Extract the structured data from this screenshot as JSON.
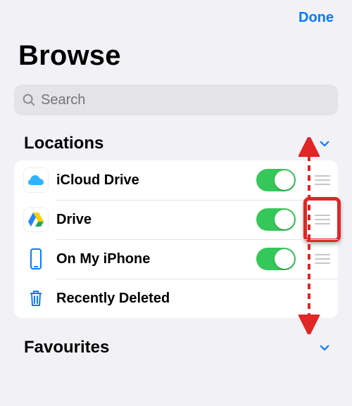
{
  "header": {
    "done_label": "Done"
  },
  "page_title": "Browse",
  "search": {
    "placeholder": "Search"
  },
  "locations": {
    "title": "Locations",
    "items": [
      {
        "label": "iCloud Drive",
        "icon": "icloud",
        "toggle": true,
        "reorderable": true
      },
      {
        "label": "Drive",
        "icon": "gdrive",
        "toggle": true,
        "reorderable": true
      },
      {
        "label": "On My iPhone",
        "icon": "iphone",
        "toggle": true,
        "reorderable": true
      },
      {
        "label": "Recently Deleted",
        "icon": "trash",
        "toggle": false,
        "reorderable": false
      }
    ]
  },
  "favourites": {
    "title": "Favourites"
  },
  "annotation": {
    "target": "reorder-handle",
    "target_row": 1,
    "direction": "vertical-both"
  },
  "colors": {
    "accent": "#007aff",
    "toggle_on": "#34c759",
    "highlight": "#e02626"
  }
}
